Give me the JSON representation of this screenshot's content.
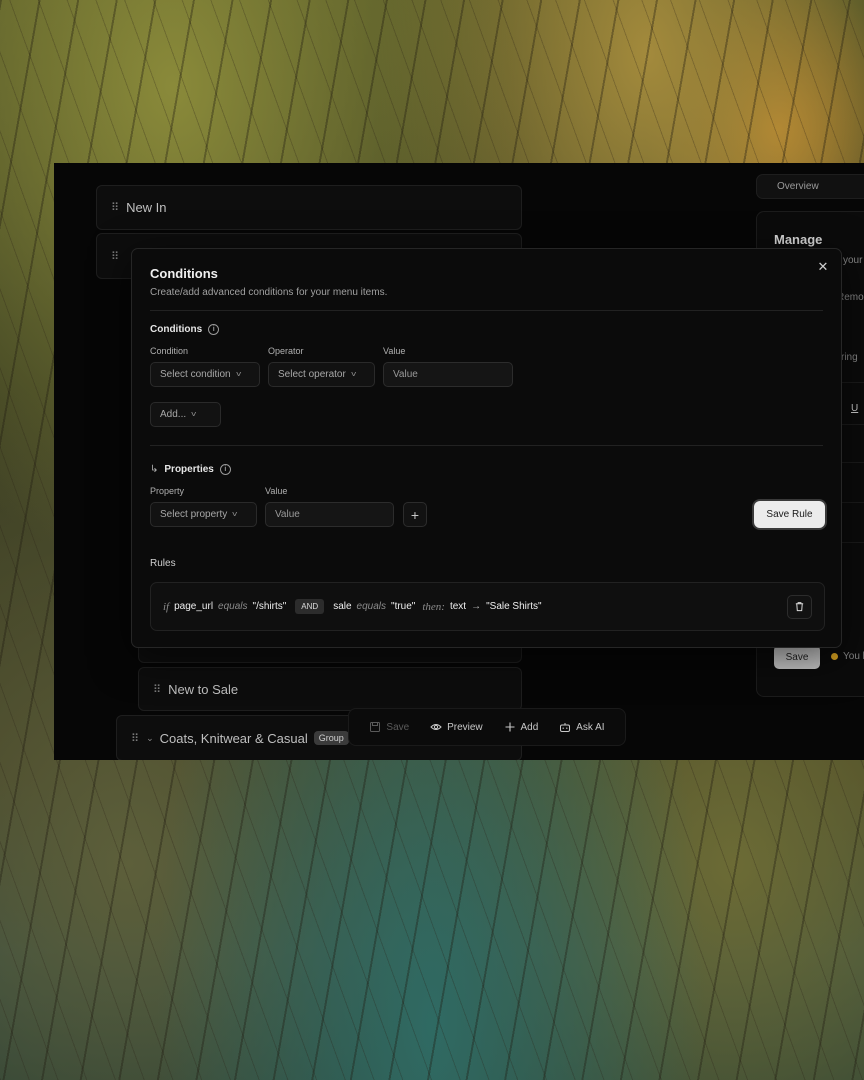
{
  "menu_items": [
    {
      "label": "New In"
    },
    {
      "label": "New to Sale"
    },
    {
      "label": "Coats, Knitwear & Casual",
      "badge": "Group"
    }
  ],
  "tabs": {
    "overview": "Overview"
  },
  "manage": {
    "title": "Manage",
    "frag_your": "your",
    "frag_remo": "Remo",
    "frag_ring": "ring",
    "save_label": "Save",
    "status_frag": "You l"
  },
  "toolbar": {
    "save": "Save",
    "preview": "Preview",
    "add": "Add",
    "ask_ai": "Ask AI"
  },
  "modal": {
    "title": "Conditions",
    "subtitle": "Create/add advanced conditions for your menu items.",
    "conditions": {
      "heading": "Conditions",
      "condition_label": "Condition",
      "condition_value": "Select condition",
      "operator_label": "Operator",
      "operator_value": "Select operator",
      "value_label": "Value",
      "value_placeholder": "Value",
      "add_label": "Add..."
    },
    "properties": {
      "heading": "Properties",
      "property_label": "Property",
      "property_value": "Select property",
      "value_label": "Value",
      "value_placeholder": "Value",
      "save_rule": "Save Rule"
    },
    "rules": {
      "heading": "Rules",
      "items": [
        {
          "if": "if",
          "field1": "page_url",
          "op1": "equals",
          "val1": "\"/shirts\"",
          "joiner": "AND",
          "field2": "sale",
          "op2": "equals",
          "val2": "\"true\"",
          "then": "then:",
          "target": "text",
          "arrow": "→",
          "result": "\"Sale Shirts\""
        }
      ]
    }
  }
}
